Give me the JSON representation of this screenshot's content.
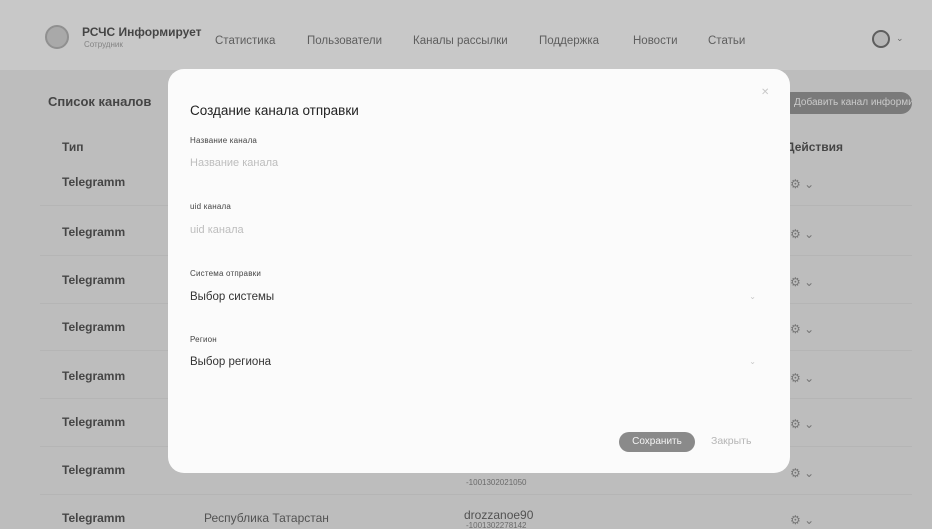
{
  "header": {
    "brand": "РСЧС Информирует",
    "brand_sub": "Сотрудник",
    "nav": [
      "Статистика",
      "Пользователи",
      "Каналы рассылки",
      "Поддержка",
      "Новости",
      "Статьи"
    ],
    "avatar_icon": "user-circle-icon",
    "chevron_icon": "chevron-down-icon"
  },
  "page": {
    "title": "Список каналов",
    "add_button": "Добавить канал информирования",
    "columns": {
      "type": "Тип",
      "actions": "Действия"
    },
    "rows": [
      {
        "type": "Telegramm"
      },
      {
        "type": "Telegramm"
      },
      {
        "type": "Telegramm"
      },
      {
        "type": "Telegramm"
      },
      {
        "type": "Telegramm"
      },
      {
        "type": "Telegramm"
      },
      {
        "type": "Telegramm",
        "channel_id": "-1001302021050"
      },
      {
        "type": "Telegramm",
        "region": "Республика Татарстан",
        "user": "drozzanoe90",
        "channel_id": "-1001302278142"
      }
    ]
  },
  "modal": {
    "title": "Создание канала отправки",
    "close_icon": "close-icon",
    "fields": {
      "name": {
        "label": "Название канала",
        "placeholder": "Название канала"
      },
      "uid": {
        "label": "uid канала",
        "placeholder": "uid канала"
      },
      "system": {
        "label": "Система отправки",
        "value": "Выбор системы"
      },
      "region": {
        "label": "Регион",
        "value": "Выбор региона"
      }
    },
    "save_label": "Сохранить",
    "close_label": "Закрыть"
  }
}
